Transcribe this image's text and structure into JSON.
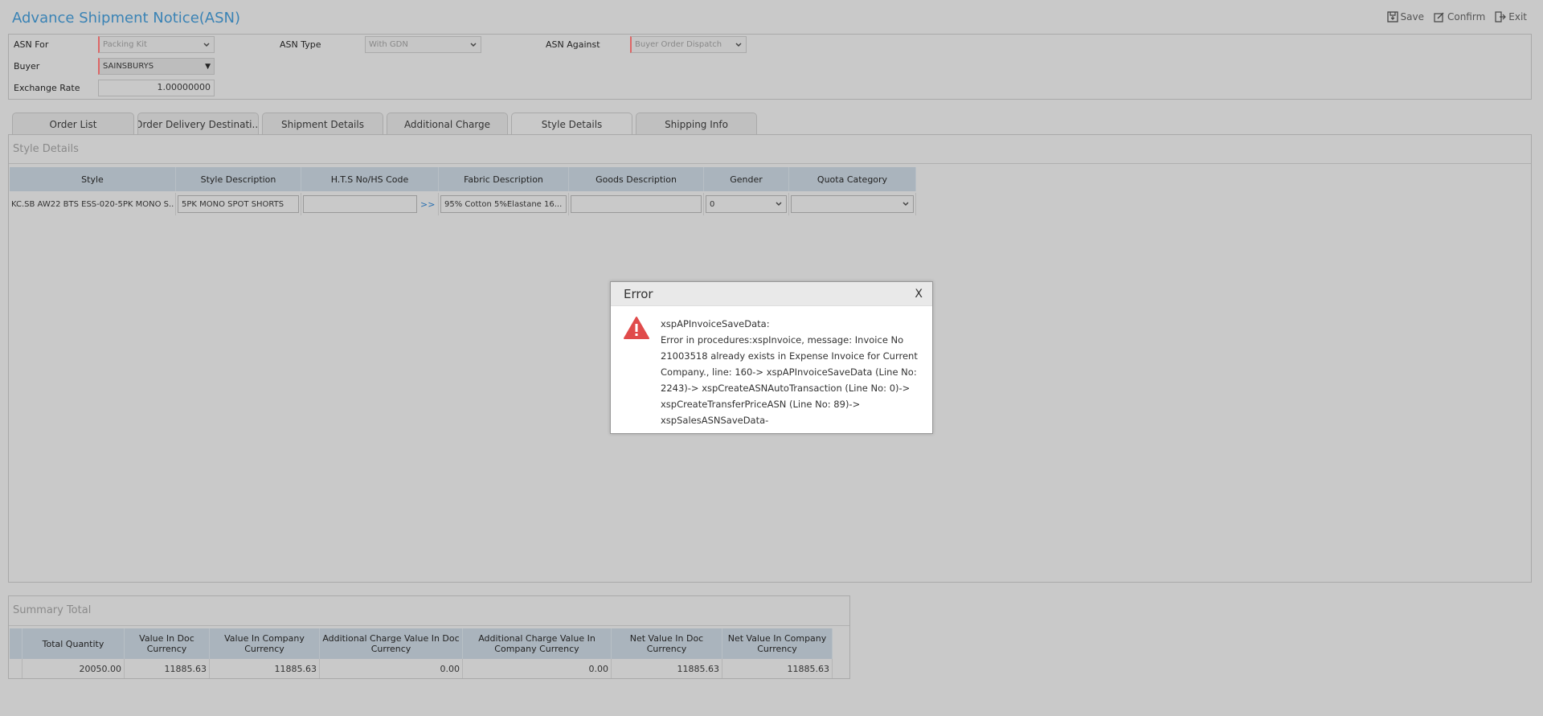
{
  "page": {
    "title": "Advance Shipment Notice(ASN)"
  },
  "toolbar": {
    "save": "Save",
    "confirm": "Confirm",
    "exit": "Exit"
  },
  "header": {
    "asn_for_label": "ASN For",
    "asn_for_value": "Packing Kit",
    "asn_type_label": "ASN Type",
    "asn_type_value": "With GDN",
    "asn_against_label": "ASN Against",
    "asn_against_value": "Buyer Order Dispatch",
    "buyer_label": "Buyer",
    "buyer_value": "SAINSBURYS",
    "exchange_rate_label": "Exchange Rate",
    "exchange_rate_value": "1.00000000"
  },
  "tabs": [
    {
      "label": "Order List"
    },
    {
      "label": "Order Delivery Destinati..."
    },
    {
      "label": "Shipment Details"
    },
    {
      "label": "Additional Charge"
    },
    {
      "label": "Style Details"
    },
    {
      "label": "Shipping Info"
    }
  ],
  "style_details": {
    "title": "Style Details",
    "columns": [
      "Style",
      "Style Description",
      "H.T.S No/HS Code",
      "Fabric Description",
      "Goods Description",
      "Gender",
      "Quota Category"
    ],
    "row": {
      "style": "KC.SB AW22 BTS ESS-020-5PK MONO S...",
      "style_description": "5PK MONO SPOT SHORTS",
      "hts_code": "",
      "hts_link": ">>",
      "fabric_description": "95% Cotton 5%Elastane 16...",
      "goods_description": "",
      "gender": "0",
      "quota_category": ""
    }
  },
  "summary": {
    "title": "Summary Total",
    "columns": [
      "Total Quantity",
      "Value In Doc Currency",
      "Value In Company Currency",
      "Additional Charge Value In Doc Currency",
      "Additional Charge Value In Company Currency",
      "Net Value In Doc Currency",
      "Net Value In Company Currency"
    ],
    "values": [
      "20050.00",
      "11885.63",
      "11885.63",
      "0.00",
      "0.00",
      "11885.63",
      "11885.63"
    ]
  },
  "dialog": {
    "title": "Error",
    "close": "X",
    "message_line1": "xspAPInvoiceSaveData:",
    "message_line2": "Error in procedures:xspInvoice, message: Invoice No 21003518 already exists in Expense Invoice for Current Company., line: 160-> xspAPInvoiceSaveData (Line No: 2243)-> xspCreateASNAutoTransaction (Line No: 0)-> xspCreateTransferPriceASN (Line No: 89)-> xspSalesASNSaveData-"
  },
  "colors": {
    "title": "#3a83b5",
    "grid_header": "#aab4bd",
    "error_icon": "#e04b4b",
    "link": "#2a6fb0"
  }
}
